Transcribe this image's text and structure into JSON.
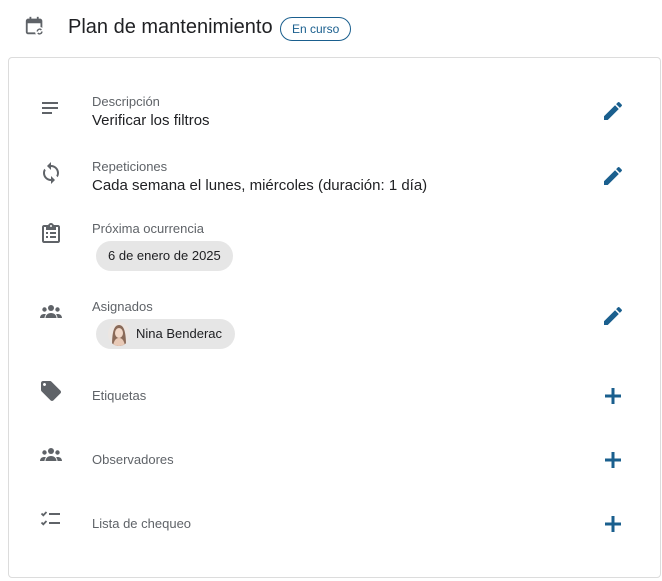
{
  "header": {
    "title": "Plan de mantenimiento",
    "status": "En curso",
    "icon": "calendar-sync-icon"
  },
  "fields": {
    "description": {
      "label": "Descripción",
      "value": "Verificar los filtros",
      "icon": "notes-icon"
    },
    "repetitions": {
      "label": "Repeticiones",
      "value": "Cada semana el lunes, miércoles (duración: 1 día)",
      "icon": "repeat-icon"
    },
    "next_occurrence": {
      "label": "Próxima ocurrencia",
      "value": "6 de enero de 2025",
      "icon": "clipboard-icon"
    },
    "assigned": {
      "label": "Asignados",
      "person": "Nina Benderac",
      "icon": "group-icon"
    },
    "tags": {
      "label": "Etiquetas",
      "icon": "tag-icon"
    },
    "observers": {
      "label": "Observadores",
      "icon": "group-icon"
    },
    "checklist": {
      "label": "Lista de chequeo",
      "icon": "checklist-icon"
    }
  },
  "colors": {
    "accent": "#1a5f8e",
    "icon_gray": "#5f6368",
    "chip_bg": "#e6e6e6",
    "border": "#dcdcdc"
  }
}
